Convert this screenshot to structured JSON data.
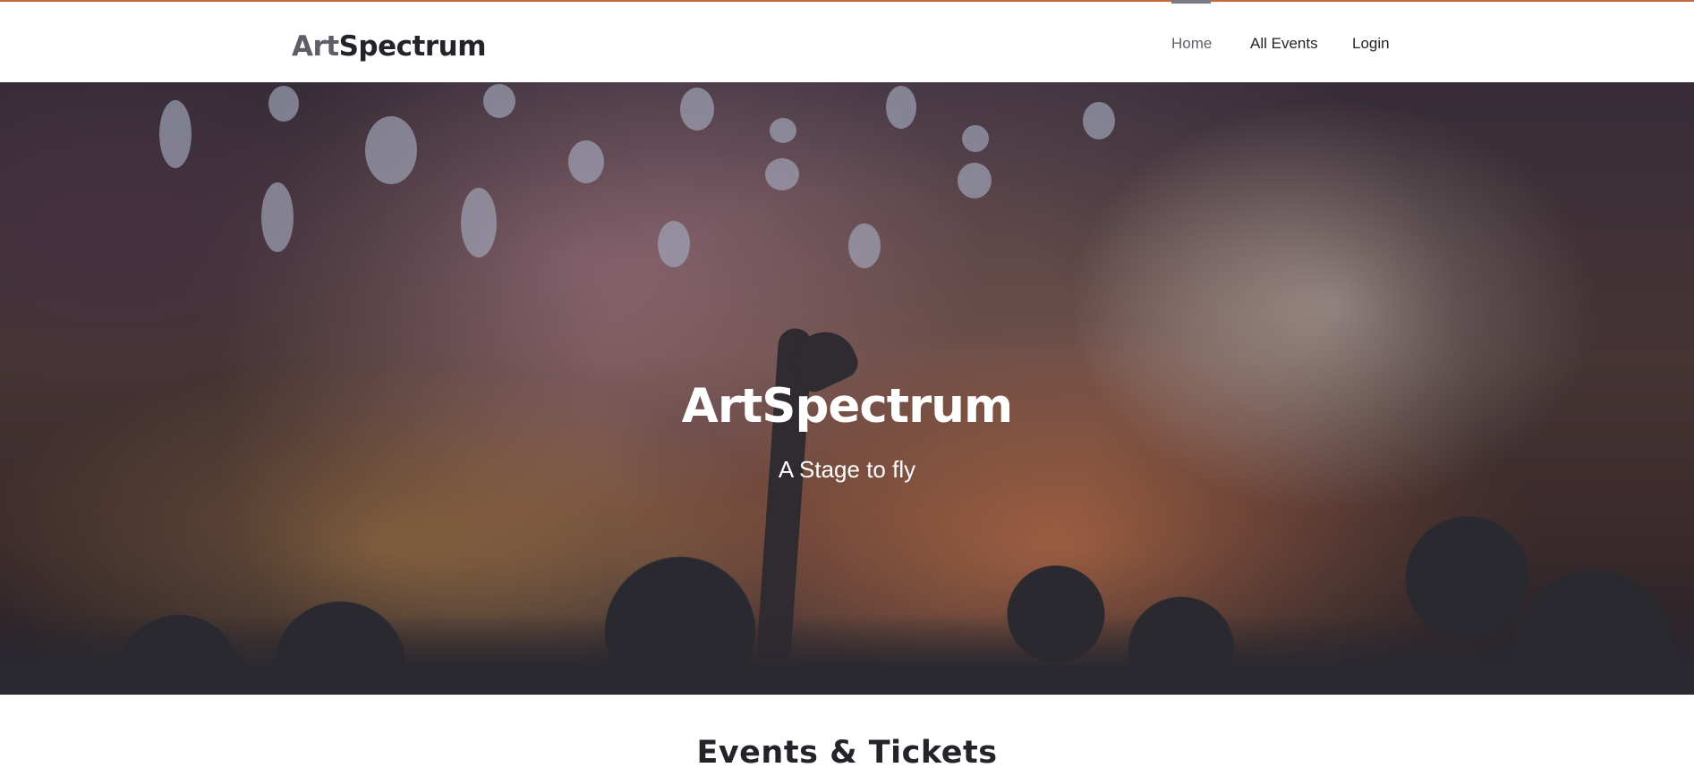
{
  "header": {
    "logo_part1": "Art",
    "logo_part2": "Spectrum",
    "nav": [
      {
        "label": "Home",
        "active": true
      },
      {
        "label": "All Events",
        "active": false
      },
      {
        "label": "Login",
        "active": false
      }
    ]
  },
  "hero": {
    "title": "ArtSpectrum",
    "subtitle": "A Stage to fly"
  },
  "main": {
    "section_title": "Events & Tickets"
  },
  "colors": {
    "accent_line": "#c8693a",
    "text_dark": "#23232a",
    "logo_grey": "#5e5e68"
  }
}
